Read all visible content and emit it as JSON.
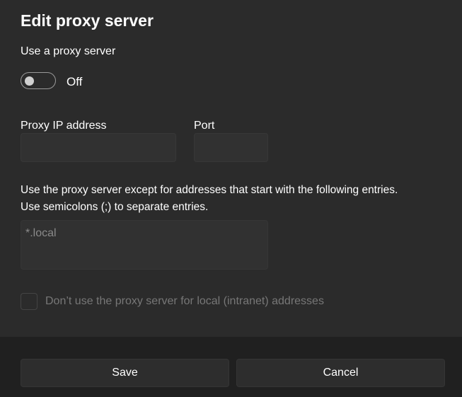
{
  "dialog": {
    "title": "Edit proxy server"
  },
  "proxy": {
    "label": "Use a proxy server",
    "toggle_state": "Off",
    "enabled": false
  },
  "ip": {
    "label": "Proxy IP address",
    "value": ""
  },
  "port": {
    "label": "Port",
    "value": ""
  },
  "exceptions": {
    "description_line1": "Use the proxy server except for addresses that start with the following entries.",
    "description_line2": "Use semicolons (;) to separate entries.",
    "value": "*.local"
  },
  "local": {
    "label": "Don’t use the proxy server for local (intranet) addresses",
    "checked": false
  },
  "buttons": {
    "save": "Save",
    "cancel": "Cancel"
  }
}
